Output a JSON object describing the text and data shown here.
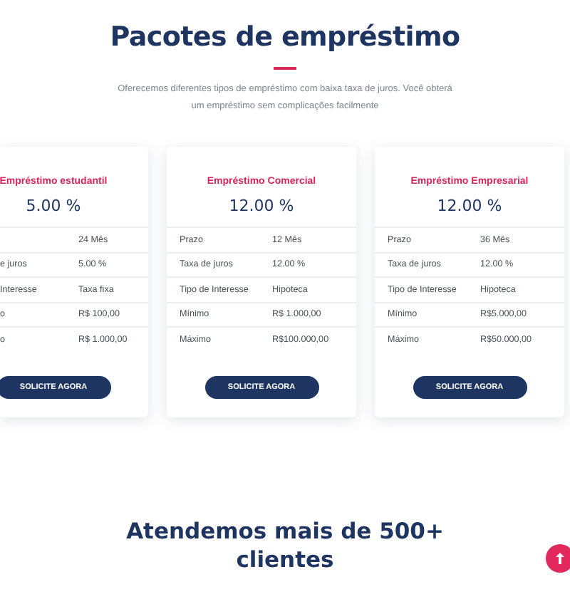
{
  "section": {
    "title": "Pacotes de empréstimo",
    "subtitle": "Oferecemos diferentes tipos de empréstimo com baixa taxa de juros. Você obterá um empréstimo sem complicações facilmente"
  },
  "cards": [
    {
      "title": "Empréstimo estudantil",
      "rate": "5.00 %",
      "rows": [
        {
          "value": "24 Mês"
        },
        {
          "label": "e juros",
          "value": "5.00 %"
        },
        {
          "label": "Interesse",
          "value": "Taxa fixa"
        },
        {
          "label": "o",
          "value": "R$ 100,00"
        },
        {
          "label": "o",
          "value": "R$ 1.000,00"
        }
      ],
      "button": "SOLICITE AGORA"
    },
    {
      "title": "Empréstimo Comercial",
      "rate": "12.00 %",
      "rows": [
        {
          "label": "Prazo",
          "value": "12 Mês"
        },
        {
          "label": "Taxa de juros",
          "value": "12.00 %"
        },
        {
          "label": "Tipo de Interesse",
          "value": "Hipoteca"
        },
        {
          "label": "Mínimo",
          "value": "R$ 1.000,00"
        },
        {
          "label": "Máximo",
          "value": "R$100.000,00"
        }
      ],
      "button": "SOLICITE AGORA"
    },
    {
      "title": "Empréstimo Empresarial",
      "rate": "12.00 %",
      "rows": [
        {
          "label": "Prazo",
          "value": "36 Mês"
        },
        {
          "label": "Taxa de juros",
          "value": "12.00 %"
        },
        {
          "label": "Tipo de Interesse",
          "value": "Hipoteca"
        },
        {
          "label": "Mínimo",
          "value": "R$5.000,00"
        },
        {
          "label": "Máximo",
          "value": "R$50.000,00"
        }
      ],
      "button": "SOLICITE AGORA"
    }
  ],
  "clients": {
    "title": "Atendemos mais de 500+ clientes"
  }
}
